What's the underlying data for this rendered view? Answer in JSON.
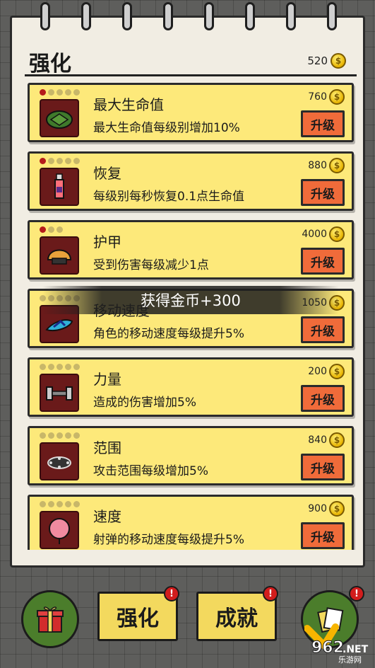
{
  "header": {
    "title": "强化",
    "coins": "520"
  },
  "items": [
    {
      "name": "最大生命值",
      "desc": "最大生命值每级别增加10%",
      "cost": "760",
      "button": "升级",
      "level": 1,
      "max": 5,
      "icon": "turtle-shell-icon"
    },
    {
      "name": "恢复",
      "desc": "每级别每秒恢复0.1点生命值",
      "cost": "880",
      "button": "升级",
      "level": 1,
      "max": 5,
      "icon": "potion-bottle-icon"
    },
    {
      "name": "护甲",
      "desc": "受到伤害每级减少1点",
      "cost": "4000",
      "button": "升级",
      "level": 1,
      "max": 3,
      "icon": "helmet-icon"
    },
    {
      "name": "移动速度",
      "desc": "角色的移动速度每级提升5%",
      "cost": "1050",
      "button": "升级",
      "level": 0,
      "max": 5,
      "icon": "flip-flop-icon"
    },
    {
      "name": "力量",
      "desc": "造成的伤害增加5%",
      "cost": "200",
      "button": "升级",
      "level": 0,
      "max": 5,
      "icon": "dumbbell-icon"
    },
    {
      "name": "范围",
      "desc": "攻击范围每级增加5%",
      "cost": "840",
      "button": "升级",
      "level": 0,
      "max": 5,
      "icon": "spiked-collar-icon"
    },
    {
      "name": "速度",
      "desc": "射弹的移动速度每级提升5%",
      "cost": "900",
      "button": "升级",
      "level": 0,
      "max": 5,
      "icon": "balloon-icon"
    }
  ],
  "toast": "获得金币+300",
  "bottom": {
    "tab_upgrade": "强化",
    "tab_achievement": "成就",
    "badge": "!"
  },
  "watermark": {
    "brand": "962",
    "tld": ".NET",
    "sub": "乐游网"
  },
  "colors": {
    "card": "#fde97a",
    "button": "#f06b3a",
    "level_dot": "#b51b1b",
    "accent_green": "#4b7d2b"
  }
}
